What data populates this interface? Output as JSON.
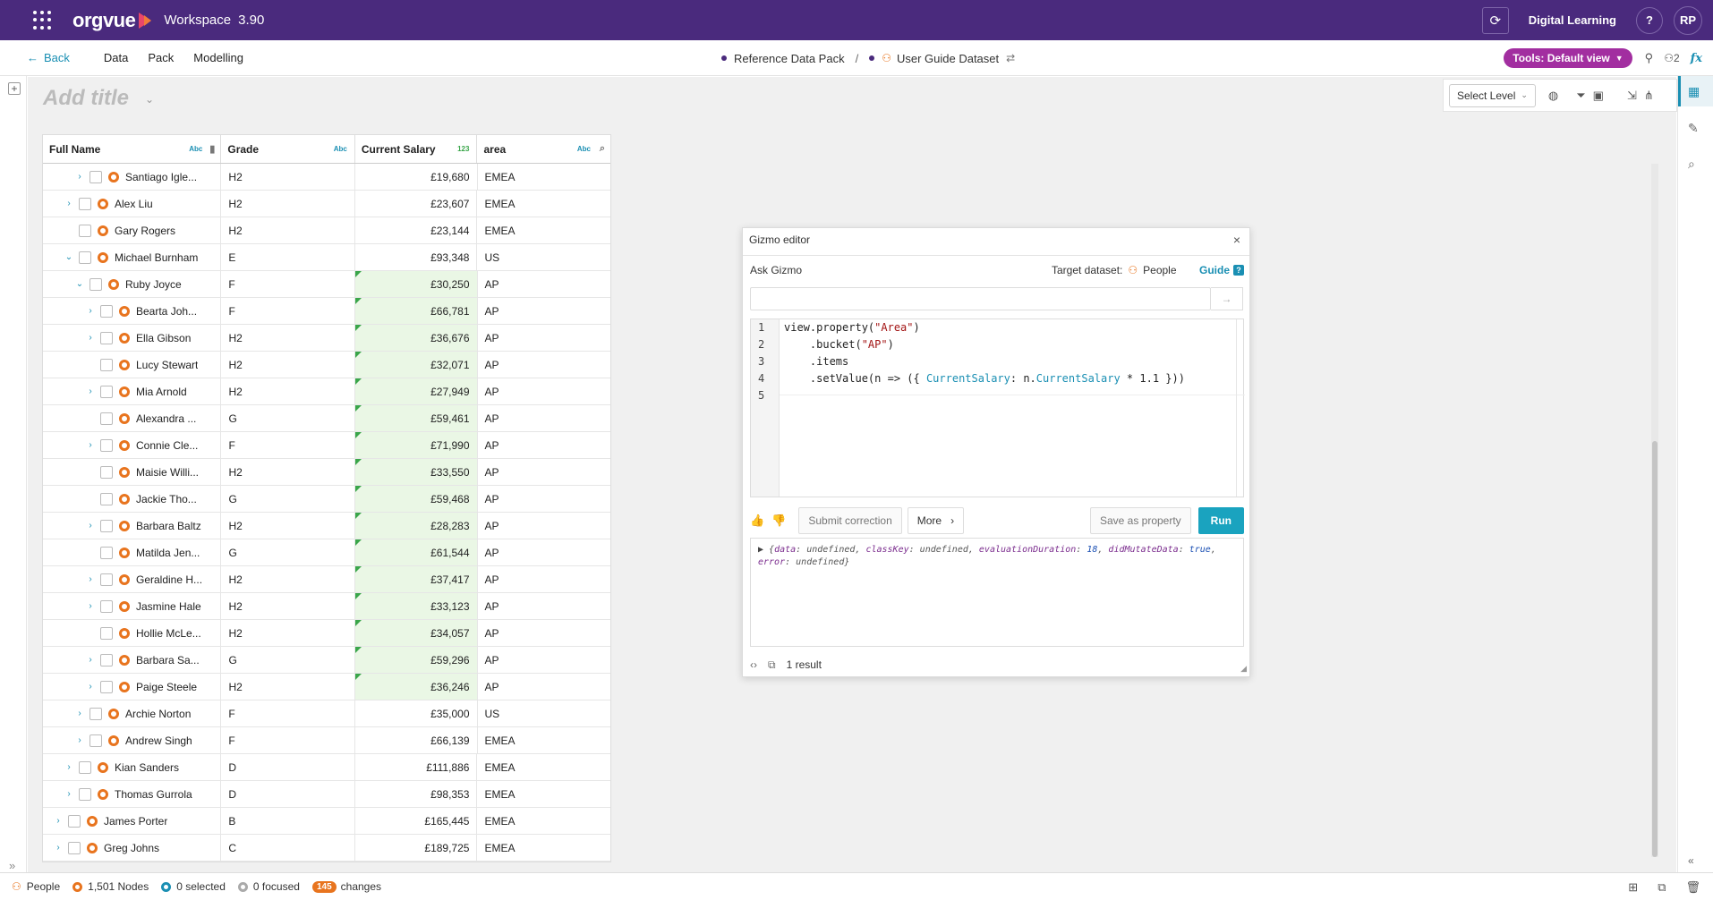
{
  "topbar": {
    "brand": "orgvue",
    "workspace": "Workspace",
    "version": "3.90",
    "user_label": "Digital Learning",
    "help": "?",
    "avatar": "RP"
  },
  "navbar": {
    "back": "Back",
    "items": [
      "Data",
      "Pack",
      "Modelling"
    ],
    "crumb_pack": "Reference Data Pack",
    "crumb_sep": "/",
    "crumb_dataset": "User Guide Dataset",
    "tools": "Tools: Default view",
    "user_count": "2"
  },
  "title": {
    "placeholder": "Add title"
  },
  "toolbar": {
    "select_level": "Select Level"
  },
  "grid": {
    "columns": [
      {
        "label": "Full Name",
        "type": "Abc"
      },
      {
        "label": "Grade",
        "type": "Abc"
      },
      {
        "label": "Current Salary",
        "type": "123"
      },
      {
        "label": "area",
        "type": "Abc"
      }
    ],
    "rows": [
      {
        "name": "Santiago Igle...",
        "grade": "H2",
        "salary": "£19,680",
        "area": "EMEA"
      },
      {
        "name": "Alex Liu",
        "grade": "H2",
        "salary": "£23,607",
        "area": "EMEA"
      },
      {
        "name": "Gary Rogers",
        "grade": "H2",
        "salary": "£23,144",
        "area": "EMEA"
      },
      {
        "name": "Michael Burnham",
        "grade": "E",
        "salary": "£93,348",
        "area": "US"
      },
      {
        "name": "Ruby Joyce",
        "grade": "F",
        "salary": "£30,250",
        "area": "AP"
      },
      {
        "name": "Bearta Joh...",
        "grade": "F",
        "salary": "£66,781",
        "area": "AP"
      },
      {
        "name": "Ella Gibson",
        "grade": "H2",
        "salary": "£36,676",
        "area": "AP"
      },
      {
        "name": "Lucy Stewart",
        "grade": "H2",
        "salary": "£32,071",
        "area": "AP"
      },
      {
        "name": "Mia Arnold",
        "grade": "H2",
        "salary": "£27,949",
        "area": "AP"
      },
      {
        "name": "Alexandra ...",
        "grade": "G",
        "salary": "£59,461",
        "area": "AP"
      },
      {
        "name": "Connie Cle...",
        "grade": "F",
        "salary": "£71,990",
        "area": "AP"
      },
      {
        "name": "Maisie Willi...",
        "grade": "H2",
        "salary": "£33,550",
        "area": "AP"
      },
      {
        "name": "Jackie Tho...",
        "grade": "G",
        "salary": "£59,468",
        "area": "AP"
      },
      {
        "name": "Barbara Baltz",
        "grade": "H2",
        "salary": "£28,283",
        "area": "AP"
      },
      {
        "name": "Matilda Jen...",
        "grade": "G",
        "salary": "£61,544",
        "area": "AP"
      },
      {
        "name": "Geraldine H...",
        "grade": "H2",
        "salary": "£37,417",
        "area": "AP"
      },
      {
        "name": "Jasmine Hale",
        "grade": "H2",
        "salary": "£33,123",
        "area": "AP"
      },
      {
        "name": "Hollie McLe...",
        "grade": "H2",
        "salary": "£34,057",
        "area": "AP"
      },
      {
        "name": "Barbara Sa...",
        "grade": "G",
        "salary": "£59,296",
        "area": "AP"
      },
      {
        "name": "Paige Steele",
        "grade": "H2",
        "salary": "£36,246",
        "area": "AP"
      },
      {
        "name": "Archie Norton",
        "grade": "F",
        "salary": "£35,000",
        "area": "US"
      },
      {
        "name": "Andrew Singh",
        "grade": "F",
        "salary": "£66,139",
        "area": "EMEA"
      },
      {
        "name": "Kian Sanders",
        "grade": "D",
        "salary": "£111,886",
        "area": "EMEA"
      },
      {
        "name": "Thomas Gurrola",
        "grade": "D",
        "salary": "£98,353",
        "area": "EMEA"
      },
      {
        "name": "James Porter",
        "grade": "B",
        "salary": "£165,445",
        "area": "EMEA"
      },
      {
        "name": "Greg Johns",
        "grade": "C",
        "salary": "£189,725",
        "area": "EMEA"
      }
    ]
  },
  "gizmo": {
    "title": "Gizmo editor",
    "close": "×",
    "ask": "Ask Gizmo",
    "target_label": "Target dataset:",
    "target_value": "People",
    "guide": "Guide",
    "guide_icon": "?",
    "send_icon": "→",
    "line_numbers": [
      "1",
      "2",
      "3",
      "4",
      "5"
    ],
    "code": {
      "l1a": "view.property(",
      "l1s": "\"Area\"",
      "l1b": ")",
      "l2a": "    .bucket(",
      "l2s": "\"AP\"",
      "l2b": ")",
      "l3": "    .items",
      "l4a": "    .setValue(n => ({ ",
      "l4p1": "CurrentSalary",
      "l4b": ": n.",
      "l4p2": "CurrentSalary",
      "l4c": " * 1.1 }))"
    },
    "submit_correction": "Submit correction",
    "more": "More",
    "save_as_property": "Save as property",
    "run": "Run",
    "result": {
      "k1": "data",
      "v1": "undefined",
      "k2": "classKey",
      "v2": "undefined",
      "k3": "evaluationDuration",
      "v3": "18",
      "k4": "didMutateData",
      "v4": "true",
      "k5": "error",
      "v5": "undefined"
    },
    "result_count": "1 result"
  },
  "status": {
    "dataset": "People",
    "nodes": "1,501 Nodes",
    "selected": "0 selected",
    "focused": "0 focused",
    "changes_count": "145",
    "changes_label": "changes"
  },
  "colors": {
    "topbar": "#4a2a7d",
    "accent": "#1a8fb3",
    "tools_button": "#a22ea0",
    "node_orange": "#e8741e",
    "edited_green": "#eaf7e5",
    "run_button": "#1aa3bf"
  }
}
